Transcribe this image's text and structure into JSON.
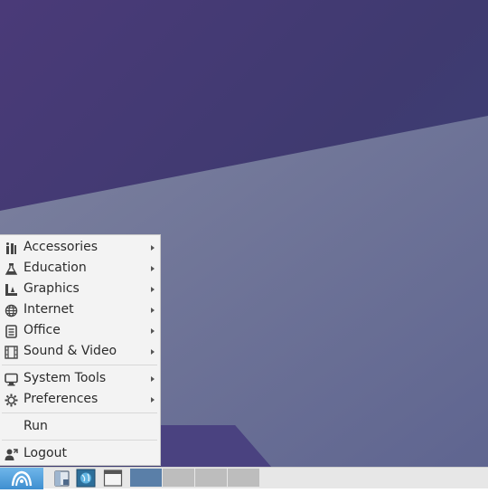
{
  "menu": {
    "items": [
      {
        "label": "Accessories",
        "icon": "accessories-icon",
        "submenu": true
      },
      {
        "label": "Education",
        "icon": "flask-icon",
        "submenu": true
      },
      {
        "label": "Graphics",
        "icon": "graphics-icon",
        "submenu": true
      },
      {
        "label": "Internet",
        "icon": "globe-icon",
        "submenu": true
      },
      {
        "label": "Office",
        "icon": "document-icon",
        "submenu": true
      },
      {
        "label": "Sound & Video",
        "icon": "film-icon",
        "submenu": true
      },
      {
        "label": "System Tools",
        "icon": "monitor-icon",
        "submenu": true
      },
      {
        "label": "Preferences",
        "icon": "gear-icon",
        "submenu": true
      },
      {
        "label": "Run",
        "icon": "",
        "submenu": false
      },
      {
        "label": "Logout",
        "icon": "logout-icon",
        "submenu": false
      }
    ]
  },
  "taskbar": {
    "start_icon": "start-menu-icon",
    "launchers": [
      "file-manager-icon",
      "web-browser-icon",
      "terminal-window-icon"
    ],
    "workspaces": [
      {
        "active": true
      },
      {
        "active": false
      },
      {
        "active": false
      },
      {
        "active": false
      }
    ]
  },
  "colors": {
    "desktop_top": "#4a3a78",
    "desktop_plane": "#6e7396",
    "menu_bg": "#f3f3f3",
    "start_button": "#4b9ad8",
    "workspace_active": "#5a7fa8",
    "workspace_inactive": "#bdbdbd"
  }
}
